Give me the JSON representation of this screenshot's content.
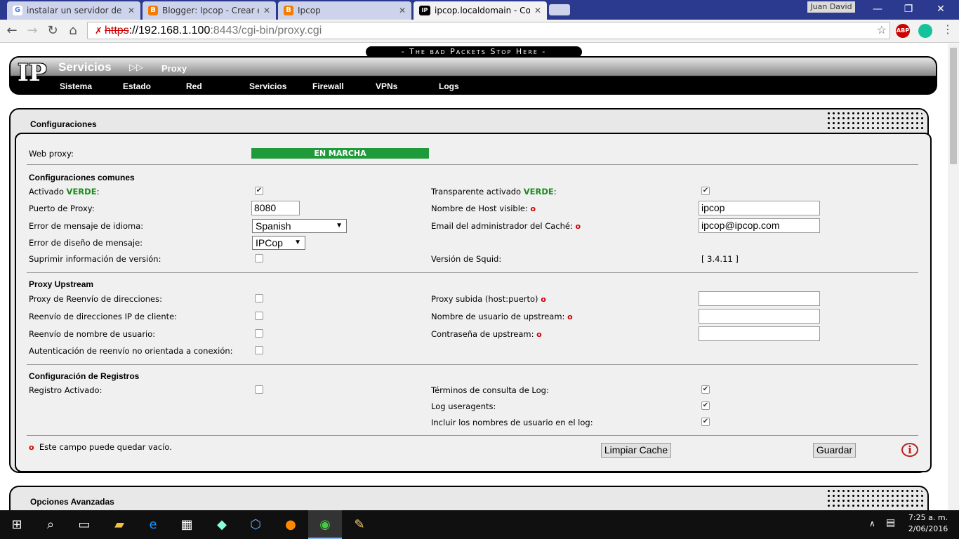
{
  "browser": {
    "tabs": [
      {
        "title": "instalar un servidor de co",
        "favicon": "G"
      },
      {
        "title": "Blogger: Ipcop - Crear ent",
        "favicon": "B"
      },
      {
        "title": "Ipcop",
        "favicon": "B"
      },
      {
        "title": "ipcop.localdomain - Confi",
        "favicon": "IP"
      }
    ],
    "user": "Juan David",
    "url": {
      "scheme": "https",
      "host": "://192.168.1.100",
      "rest": ":8443/cgi-bin/proxy.cgi"
    }
  },
  "header": {
    "slogan": "- The bad Packets Stop Here -",
    "logo": "IP",
    "section": "Servicios",
    "page": "Proxy",
    "menu": [
      "Sistema",
      "Estado",
      "Red",
      "Servicios",
      "Firewall",
      "VPNs",
      "Logs"
    ]
  },
  "config": {
    "title": "Configuraciones",
    "web_proxy_label": "Web proxy:",
    "status": "EN MARCHA",
    "common_title": "Configuraciones comunes",
    "enabled_label": "Activado",
    "green_word": "VERDE",
    "transparent_label": "Transparente activado",
    "port_label": "Puerto de Proxy:",
    "port_value": "8080",
    "hostname_label": "Nombre de Host visible:",
    "hostname_value": "ipcop",
    "lang_label": "Error de mensaje de idioma:",
    "lang_value": "Spanish",
    "admin_email_label": "Email del administrador del Caché:",
    "admin_email_value": "ipcop@ipcop.com",
    "design_label": "Error de diseño de mensaje:",
    "design_value": "IPCop",
    "suppress_label": "Suprimir información de versión:",
    "squid_label": "Versión de Squid:",
    "squid_value": "[ 3.4.11 ]",
    "upstream_title": "Proxy Upstream",
    "forward_label": "Proxy de Reenvío de direcciones:",
    "upstream_host_label": "Proxy subida (host:puerto)",
    "client_ip_label": "Reenvío de direcciones IP de cliente:",
    "upstream_user_label": "Nombre de usuario de upstream:",
    "username_fwd_label": "Reenvío de nombre de usuario:",
    "upstream_pass_label": "Contraseña de upstream:",
    "auth_fwd_label": "Autenticación de reenvío no orientada a conexión:",
    "log_title": "Configuración de Registros",
    "log_enabled_label": "Registro Activado:",
    "log_query_label": "Términos de consulta de Log:",
    "log_ua_label": "Log useragents:",
    "log_users_label": "Incluir los nombres de usuario en el log:",
    "note": "Este campo puede quedar vacío.",
    "clear_cache_label": "Limpiar Cache",
    "save_label": "Guardar",
    "info_icon": "i",
    "checks": {
      "enabled": true,
      "transparent": true,
      "suppress": false,
      "forward": false,
      "client_ip": false,
      "username_fwd": false,
      "auth_fwd": false,
      "log_enabled": false,
      "log_query": true,
      "log_ua": true,
      "log_users": true
    }
  },
  "advanced": {
    "title": "Opciones Avanzadas"
  },
  "taskbar": {
    "time": "7:25 a. m.",
    "date": "2/06/2016"
  }
}
